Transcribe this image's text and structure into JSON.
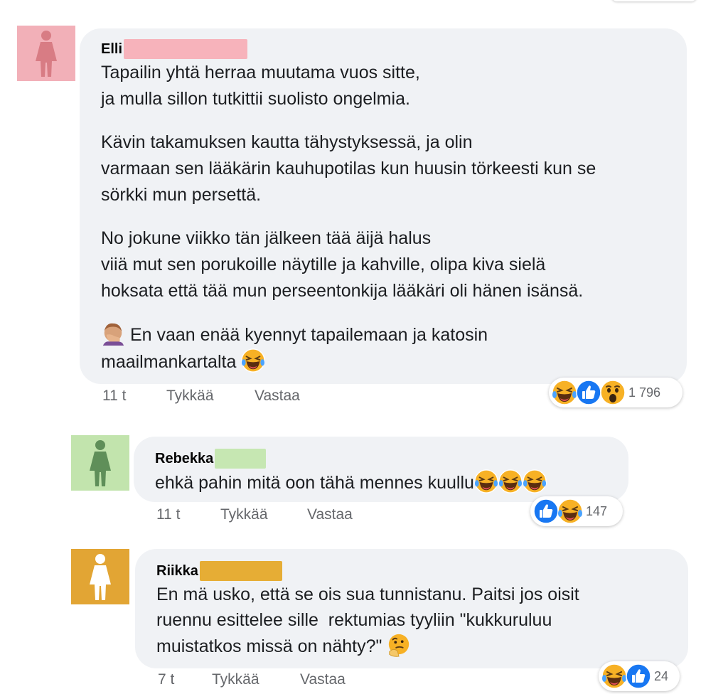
{
  "comments": [
    {
      "author": "Elli",
      "redact_color": "#f7b3bb",
      "avatar_color": "#f2b0b8",
      "avatar_figure_color": "#d87c84",
      "paragraphs": [
        "Tapailin yhtä herraa muutama vuos sitte,\nja mulla sillon tutkittii suolisto ongelmia.",
        "Kävin takamuksen kautta tähystyksessä, ja olin\nvarmaan sen lääkärin kauhupotilas kun huusin törkeesti kun se\nsörkki mun persettä.",
        "No jokune viikko tän jälkeen tää äijä halus\nviiä mut sen porukoille näytille ja kahville, olipa kiva sielä\nhoksata että tää mun perseentonkija lääkäri oli hänen isänsä."
      ],
      "last_line_1": "En vaan enää kyennyt tapailemaan ja katosin",
      "last_line_2": "maailmankartalta",
      "time": "11 t",
      "like": "Tykkää",
      "reply": "Vastaa",
      "reaction_count": "1 796"
    },
    {
      "author": "Rebekka",
      "redact_color": "#c6e7b2",
      "avatar_color": "#c2e4ad",
      "avatar_figure_color": "#5f8f59",
      "text": "ehkä pahin mitä oon tähä mennes kuullu",
      "time": "11 t",
      "like": "Tykkää",
      "reply": "Vastaa",
      "reaction_count": "147"
    },
    {
      "author": "Riikka",
      "redact_color": "#e6ad35",
      "avatar_color": "#e2a534",
      "avatar_figure_color": "#ffffff",
      "line_1": "En mä usko, että se ois sua tunnistanu. Paitsi jos oisit",
      "line_2": "ruennu esittelee sille  rektumias tyyliin \"kukkuruluu",
      "line_3": "muistatkos missä on nähty?\"",
      "time": "7 t",
      "like": "Tykkää",
      "reply": "Vastaa",
      "reaction_count": "24"
    }
  ],
  "icons": {
    "avatar": "person-silhouette-icon",
    "laugh": "laughing-tears-emoji",
    "like": "like-reaction-icon",
    "wow": "wow-reaction-emoji",
    "facepalm": "facepalm-emoji",
    "thinking": "thinking-emoji"
  },
  "colors": {
    "bubble": "#f0f2f5",
    "meta_text": "#65676b",
    "like_blue": "#1877f2",
    "emoji_yellow": "#f7b125"
  }
}
